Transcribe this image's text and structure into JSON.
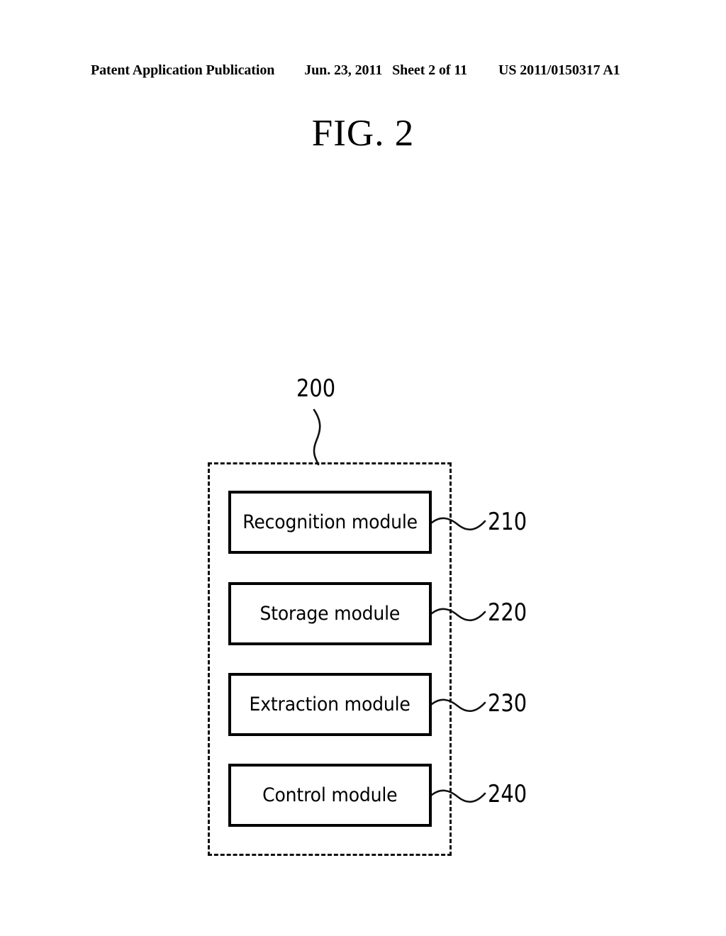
{
  "header": {
    "publication": "Patent Application Publication",
    "date": "Jun. 23, 2011",
    "sheet": "Sheet 2 of 11",
    "document_number": "US 2011/0150317 A1"
  },
  "figure": {
    "title": "FIG. 2",
    "container_ref": "200",
    "modules": [
      {
        "label": "Recognition module",
        "ref": "210"
      },
      {
        "label": "Storage module",
        "ref": "220"
      },
      {
        "label": "Extraction module",
        "ref": "230"
      },
      {
        "label": "Control module",
        "ref": "240"
      }
    ]
  },
  "colors": {
    "ink": "#000000",
    "paper": "#ffffff"
  }
}
